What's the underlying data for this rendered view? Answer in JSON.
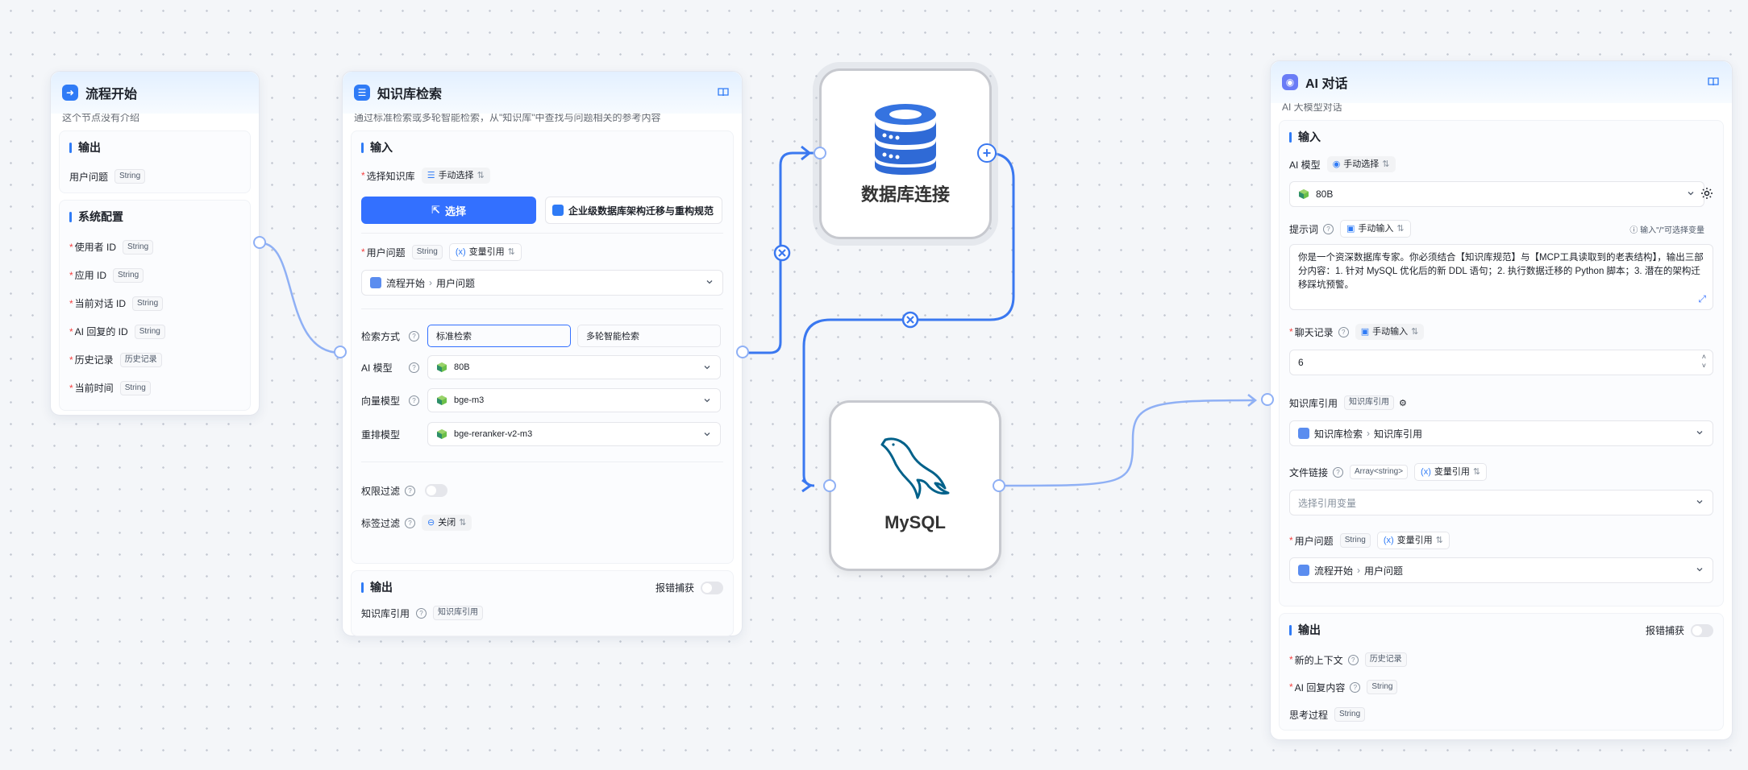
{
  "start": {
    "title": "流程开始",
    "desc": "这个节点没有介绍",
    "output_title": "输出",
    "output_field": "用户问题",
    "output_type": "String",
    "sys_title": "系统配置",
    "sys_fields": [
      {
        "label": "使用者 ID",
        "type": "String"
      },
      {
        "label": "应用 ID",
        "type": "String"
      },
      {
        "label": "当前对话 ID",
        "type": "String"
      },
      {
        "label": "AI 回复的 ID",
        "type": "String"
      },
      {
        "label": "历史记录",
        "type": "历史记录"
      },
      {
        "label": "当前时间",
        "type": "String"
      }
    ]
  },
  "kb": {
    "title": "知识库检索",
    "desc": "通过标准检索或多轮智能检索，从\"知识库\"中查找与问题相关的参考内容",
    "input_title": "输入",
    "select_kb_label": "选择知识库",
    "select_kb_mode": "手动选择",
    "select_btn": "选择",
    "kb_item": "企业级数据库架构迁移与重构规范",
    "question_label": "用户问题",
    "question_type": "String",
    "question_mode": "变量引用",
    "question_ref_source": "流程开始",
    "question_ref_field": "用户问题",
    "search_mode_label": "检索方式",
    "search_standard": "标准检索",
    "search_multi": "多轮智能检索",
    "ai_model_label": "AI 模型",
    "ai_model_value": "80B",
    "vector_label": "向量模型",
    "vector_value": "bge-m3",
    "rerank_label": "重排模型",
    "rerank_value": "bge-reranker-v2-m3",
    "perm_label": "权限过滤",
    "tag_label": "标签过滤",
    "tag_value": "关闭",
    "output_title": "输出",
    "catch_label": "报错捕获",
    "out_field": "知识库引用",
    "out_type": "知识库引用"
  },
  "db_card": {
    "label": "数据库连接"
  },
  "mysql_card": {
    "label": "MySQL"
  },
  "ai": {
    "title": "AI 对话",
    "desc": "AI 大模型对话",
    "input_title": "输入",
    "model_label": "AI 模型",
    "model_mode": "手动选择",
    "model_value": "80B",
    "prompt_label": "提示词",
    "prompt_mode": "手动输入",
    "prompt_hint": "输入\"/\"可选择变量",
    "prompt_text": "你是一个资深数据库专家。你必须结合【知识库规范】与【MCP工具读取到的老表结构】，输出三部分内容：1. 针对 MySQL 优化后的新 DDL 语句；2. 执行数据迁移的 Python 脚本；3. 潜在的架构迁移踩坑预警。",
    "history_label": "聊天记录",
    "history_mode": "手动输入",
    "history_value": "6",
    "kbref_label": "知识库引用",
    "kbref_type": "知识库引用",
    "kbref_source": "知识库检索",
    "kbref_field": "知识库引用",
    "file_label": "文件链接",
    "file_type": "Array<string>",
    "file_mode": "变量引用",
    "file_placeholder": "选择引用变量",
    "question_label": "用户问题",
    "question_type": "String",
    "question_mode": "变量引用",
    "question_source": "流程开始",
    "question_field": "用户问题",
    "output_title": "输出",
    "catch_label": "报错捕获",
    "out_fields": [
      {
        "label": "新的上下文",
        "type": "历史记录",
        "required": true
      },
      {
        "label": "AI 回复内容",
        "type": "String",
        "required": true
      },
      {
        "label": "思考过程",
        "type": "String",
        "required": false
      }
    ]
  },
  "colors": {
    "accent": "#3370ff",
    "edge": "#8fb0f5",
    "edge_active": "#3a78f0"
  }
}
